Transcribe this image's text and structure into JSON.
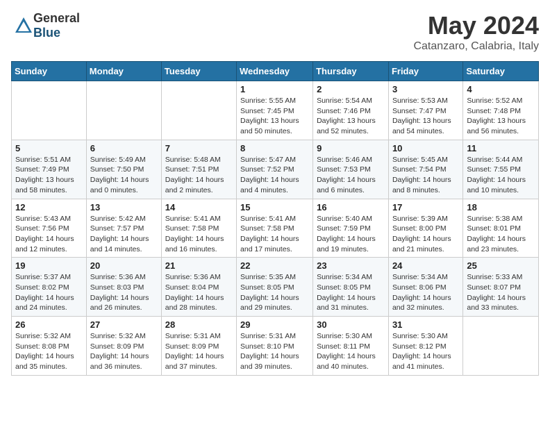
{
  "header": {
    "logo_general": "General",
    "logo_blue": "Blue",
    "month": "May 2024",
    "location": "Catanzaro, Calabria, Italy"
  },
  "columns": [
    "Sunday",
    "Monday",
    "Tuesday",
    "Wednesday",
    "Thursday",
    "Friday",
    "Saturday"
  ],
  "weeks": [
    [
      {
        "day": "",
        "info": ""
      },
      {
        "day": "",
        "info": ""
      },
      {
        "day": "",
        "info": ""
      },
      {
        "day": "1",
        "info": "Sunrise: 5:55 AM\nSunset: 7:45 PM\nDaylight: 13 hours\nand 50 minutes."
      },
      {
        "day": "2",
        "info": "Sunrise: 5:54 AM\nSunset: 7:46 PM\nDaylight: 13 hours\nand 52 minutes."
      },
      {
        "day": "3",
        "info": "Sunrise: 5:53 AM\nSunset: 7:47 PM\nDaylight: 13 hours\nand 54 minutes."
      },
      {
        "day": "4",
        "info": "Sunrise: 5:52 AM\nSunset: 7:48 PM\nDaylight: 13 hours\nand 56 minutes."
      }
    ],
    [
      {
        "day": "5",
        "info": "Sunrise: 5:51 AM\nSunset: 7:49 PM\nDaylight: 13 hours\nand 58 minutes."
      },
      {
        "day": "6",
        "info": "Sunrise: 5:49 AM\nSunset: 7:50 PM\nDaylight: 14 hours\nand 0 minutes."
      },
      {
        "day": "7",
        "info": "Sunrise: 5:48 AM\nSunset: 7:51 PM\nDaylight: 14 hours\nand 2 minutes."
      },
      {
        "day": "8",
        "info": "Sunrise: 5:47 AM\nSunset: 7:52 PM\nDaylight: 14 hours\nand 4 minutes."
      },
      {
        "day": "9",
        "info": "Sunrise: 5:46 AM\nSunset: 7:53 PM\nDaylight: 14 hours\nand 6 minutes."
      },
      {
        "day": "10",
        "info": "Sunrise: 5:45 AM\nSunset: 7:54 PM\nDaylight: 14 hours\nand 8 minutes."
      },
      {
        "day": "11",
        "info": "Sunrise: 5:44 AM\nSunset: 7:55 PM\nDaylight: 14 hours\nand 10 minutes."
      }
    ],
    [
      {
        "day": "12",
        "info": "Sunrise: 5:43 AM\nSunset: 7:56 PM\nDaylight: 14 hours\nand 12 minutes."
      },
      {
        "day": "13",
        "info": "Sunrise: 5:42 AM\nSunset: 7:57 PM\nDaylight: 14 hours\nand 14 minutes."
      },
      {
        "day": "14",
        "info": "Sunrise: 5:41 AM\nSunset: 7:58 PM\nDaylight: 14 hours\nand 16 minutes."
      },
      {
        "day": "15",
        "info": "Sunrise: 5:41 AM\nSunset: 7:58 PM\nDaylight: 14 hours\nand 17 minutes."
      },
      {
        "day": "16",
        "info": "Sunrise: 5:40 AM\nSunset: 7:59 PM\nDaylight: 14 hours\nand 19 minutes."
      },
      {
        "day": "17",
        "info": "Sunrise: 5:39 AM\nSunset: 8:00 PM\nDaylight: 14 hours\nand 21 minutes."
      },
      {
        "day": "18",
        "info": "Sunrise: 5:38 AM\nSunset: 8:01 PM\nDaylight: 14 hours\nand 23 minutes."
      }
    ],
    [
      {
        "day": "19",
        "info": "Sunrise: 5:37 AM\nSunset: 8:02 PM\nDaylight: 14 hours\nand 24 minutes."
      },
      {
        "day": "20",
        "info": "Sunrise: 5:36 AM\nSunset: 8:03 PM\nDaylight: 14 hours\nand 26 minutes."
      },
      {
        "day": "21",
        "info": "Sunrise: 5:36 AM\nSunset: 8:04 PM\nDaylight: 14 hours\nand 28 minutes."
      },
      {
        "day": "22",
        "info": "Sunrise: 5:35 AM\nSunset: 8:05 PM\nDaylight: 14 hours\nand 29 minutes."
      },
      {
        "day": "23",
        "info": "Sunrise: 5:34 AM\nSunset: 8:05 PM\nDaylight: 14 hours\nand 31 minutes."
      },
      {
        "day": "24",
        "info": "Sunrise: 5:34 AM\nSunset: 8:06 PM\nDaylight: 14 hours\nand 32 minutes."
      },
      {
        "day": "25",
        "info": "Sunrise: 5:33 AM\nSunset: 8:07 PM\nDaylight: 14 hours\nand 33 minutes."
      }
    ],
    [
      {
        "day": "26",
        "info": "Sunrise: 5:32 AM\nSunset: 8:08 PM\nDaylight: 14 hours\nand 35 minutes."
      },
      {
        "day": "27",
        "info": "Sunrise: 5:32 AM\nSunset: 8:09 PM\nDaylight: 14 hours\nand 36 minutes."
      },
      {
        "day": "28",
        "info": "Sunrise: 5:31 AM\nSunset: 8:09 PM\nDaylight: 14 hours\nand 37 minutes."
      },
      {
        "day": "29",
        "info": "Sunrise: 5:31 AM\nSunset: 8:10 PM\nDaylight: 14 hours\nand 39 minutes."
      },
      {
        "day": "30",
        "info": "Sunrise: 5:30 AM\nSunset: 8:11 PM\nDaylight: 14 hours\nand 40 minutes."
      },
      {
        "day": "31",
        "info": "Sunrise: 5:30 AM\nSunset: 8:12 PM\nDaylight: 14 hours\nand 41 minutes."
      },
      {
        "day": "",
        "info": ""
      }
    ]
  ]
}
